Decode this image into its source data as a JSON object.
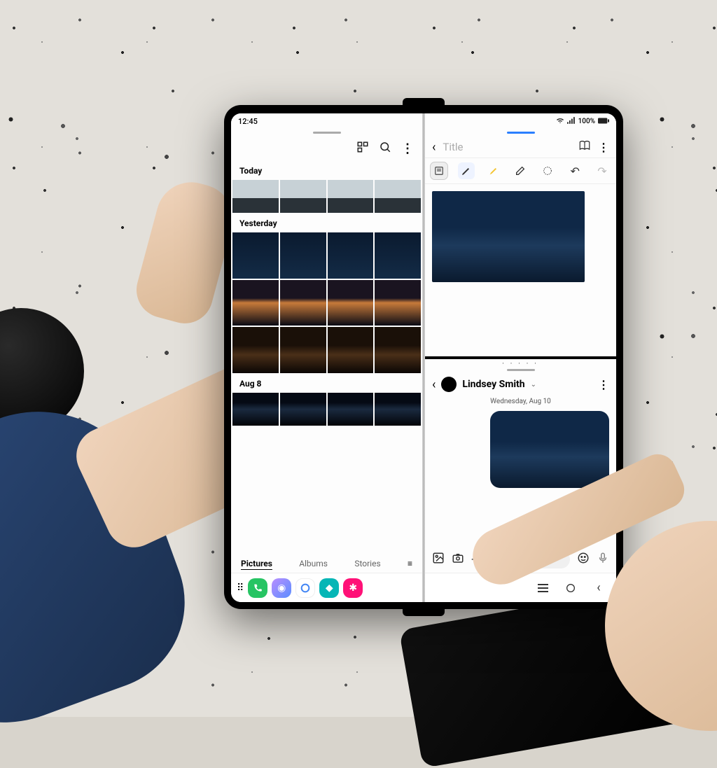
{
  "status": {
    "time": "12:45",
    "battery": "100%"
  },
  "gallery": {
    "sections": [
      "Today",
      "Yesterday",
      "Aug 8"
    ],
    "tabs": {
      "pictures": "Pictures",
      "albums": "Albums",
      "stories": "Stories"
    }
  },
  "notes": {
    "title_placeholder": "Title"
  },
  "chat": {
    "name": "Lindsey Smith",
    "date": "Wednesday, Aug 10"
  },
  "colors": {
    "phone": "#2a7fff",
    "green": "#26c463",
    "purple": "#b98eff",
    "pink": "#ff1177",
    "teal": "#06b6b6",
    "blue": "#1a73e8"
  }
}
